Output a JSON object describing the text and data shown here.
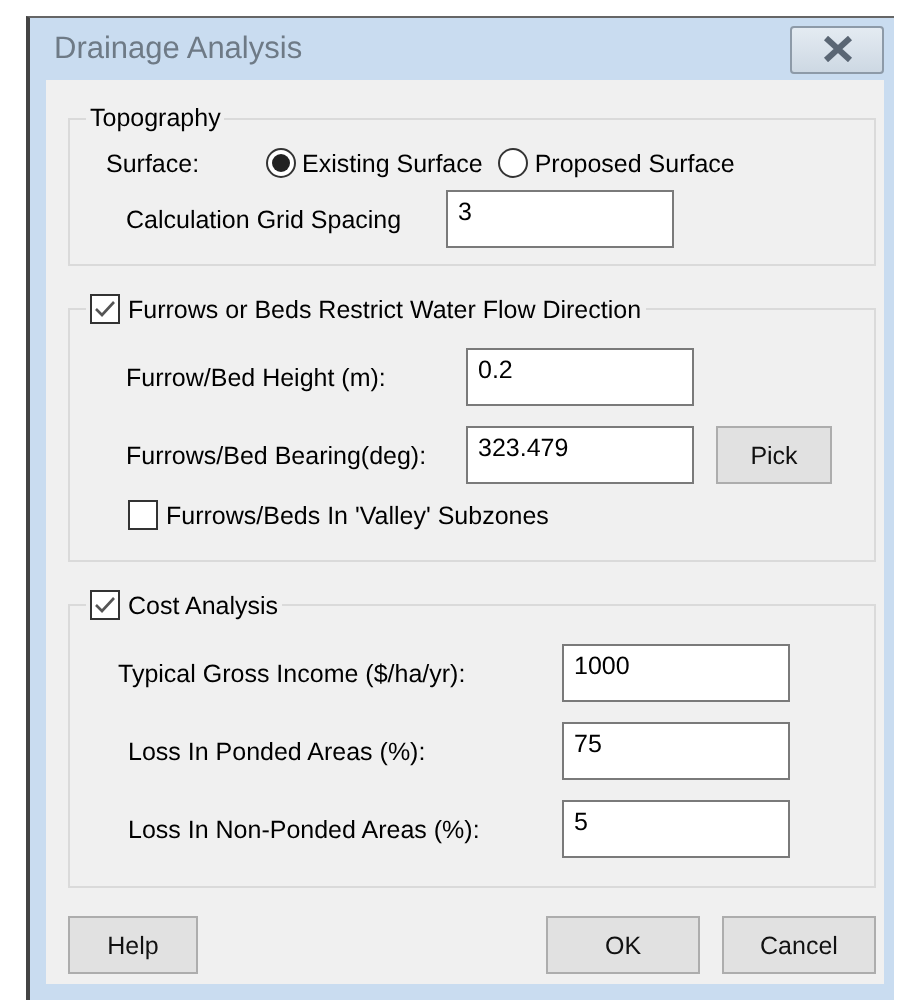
{
  "window": {
    "title": "Drainage Analysis"
  },
  "topography": {
    "legend": "Topography",
    "surface_label": "Surface:",
    "surface_options": [
      {
        "label": "Existing Surface",
        "selected": true
      },
      {
        "label": "Proposed Surface",
        "selected": false
      }
    ],
    "grid_spacing": {
      "label": "Calculation Grid Spacing",
      "value": "3"
    }
  },
  "furrows": {
    "label": "Furrows or Beds Restrict Water Flow Direction",
    "checked": true,
    "fields": [
      {
        "label": "Furrow/Bed Height (m):",
        "value": "0.2"
      },
      {
        "label": "Furrows/Bed Bearing(deg):",
        "value": "323.479",
        "button": "Pick"
      }
    ],
    "valley": {
      "label": "Furrows/Beds In 'Valley' Subzones",
      "checked": false
    }
  },
  "cost": {
    "label": "Cost Analysis",
    "checked": true,
    "fields": [
      {
        "label": "Typical Gross Income ($/ha/yr):",
        "value": "1000"
      },
      {
        "label": "Loss In Ponded Areas (%):",
        "value": "75"
      },
      {
        "label": "Loss In Non-Ponded Areas (%):",
        "value": "5"
      }
    ]
  },
  "buttons": [
    {
      "label": "Help"
    },
    {
      "label": "OK"
    },
    {
      "label": "Cancel"
    }
  ]
}
